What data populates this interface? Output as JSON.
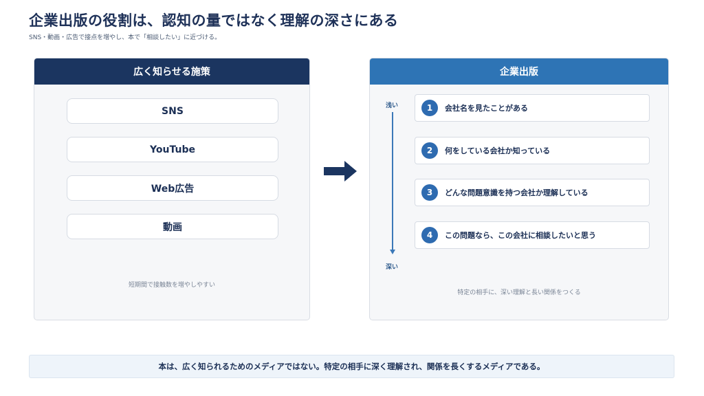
{
  "header": {
    "title": "企業出版の役割は、認知の量ではなく理解の深さにある",
    "subtitle": "SNS・動画・広告で接点を増やし、本で「相談したい」に近づける。"
  },
  "left_panel": {
    "title": "広く知らせる施策",
    "items": [
      "SNS",
      "YouTube",
      "Web広告",
      "動画"
    ],
    "note": "短期間で接触数を増やしやすい"
  },
  "right_panel": {
    "title": "企業出版",
    "axis_top": "浅い",
    "axis_bottom": "深い",
    "stages": [
      {
        "num": "1",
        "text": "会社名を見たことがある"
      },
      {
        "num": "2",
        "text": "何をしている会社か知っている"
      },
      {
        "num": "3",
        "text": "どんな問題意識を持つ会社か理解している"
      },
      {
        "num": "4",
        "text": "この問題なら、この会社に相談したいと思う"
      }
    ],
    "note": "特定の相手に、深い理解と長い関係をつくる"
  },
  "footer": {
    "text": "本は、広く知られるためのメディアではない。特定の相手に深く理解され、関係を長くするメディアである。"
  },
  "colors": {
    "navy": "#1b3560",
    "blue": "#2e74b5",
    "panel_bg": "#f6f7f9"
  }
}
